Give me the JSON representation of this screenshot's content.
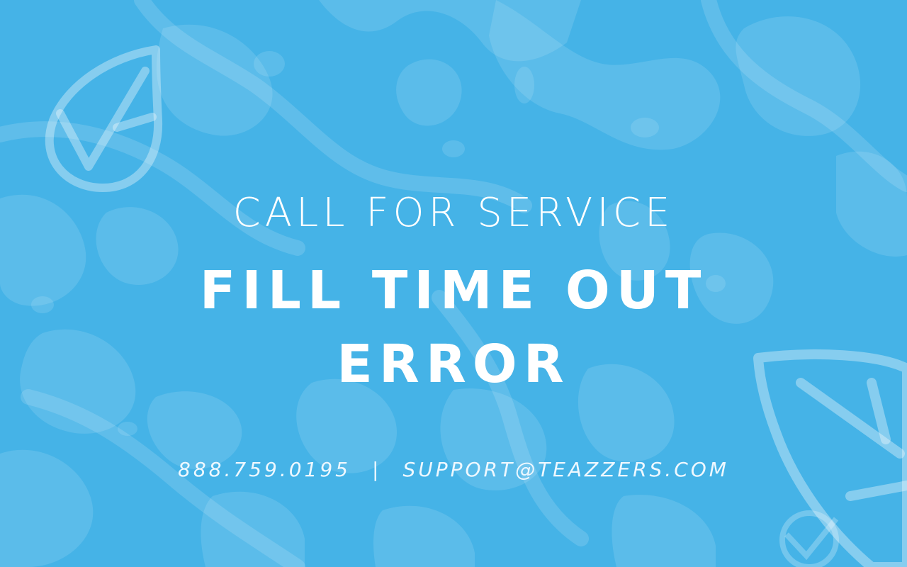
{
  "message": {
    "eyebrow": "CALL FOR SERVICE",
    "headline_line1": "FILL TIME OUT",
    "headline_line2": "ERROR"
  },
  "contact": {
    "phone": "888.759.0195",
    "separator": "|",
    "email": "SUPPORT@TEAZZERS.COM"
  },
  "colors": {
    "background": "#45b3e7",
    "pattern_light": "#7ccaf0",
    "text": "#ffffff"
  },
  "icons": {
    "top_left": "leaf-logo-icon",
    "bottom_right": "leaf-logo-icon"
  }
}
